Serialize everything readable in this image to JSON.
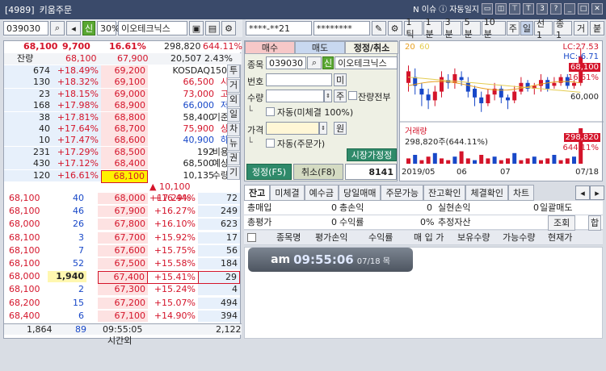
{
  "window": {
    "id": "[4989]",
    "title": "키움주문",
    "news": "N 이슈",
    "journal": "자동일지",
    "badge": "3"
  },
  "left": {
    "code": "039030",
    "shin": "신",
    "margin": "30%",
    "name": "이오테크닉스",
    "price": "68,100",
    "change": "9,700",
    "rate": "16.61%",
    "volume": "298,820",
    "vol_ratio": "644.11%",
    "remain_label": "잔량",
    "ref_price": "68,100",
    "base": "67,900",
    "amt": "20,507",
    "pct": "2.43%",
    "sell_rows": [
      {
        "qty": "674",
        "rate": "+18.49%",
        "price": "69,200"
      },
      {
        "qty": "130",
        "rate": "+18.32%",
        "price": "69,100"
      },
      {
        "qty": "23",
        "rate": "+18.15%",
        "price": "69,000"
      },
      {
        "qty": "168",
        "rate": "+17.98%",
        "price": "68,900"
      },
      {
        "qty": "38",
        "rate": "+17.81%",
        "price": "68,800"
      },
      {
        "qty": "40",
        "rate": "+17.64%",
        "price": "68,700"
      },
      {
        "qty": "10",
        "rate": "+17.47%",
        "price": "68,600"
      },
      {
        "qty": "231",
        "rate": "+17.29%",
        "price": "68,500"
      },
      {
        "qty": "430",
        "rate": "+17.12%",
        "price": "68,400"
      },
      {
        "qty": "120",
        "rate": "+16.61%",
        "price": "68,100"
      }
    ],
    "info": [
      {
        "v": "KOSDAQ150",
        "l": ""
      },
      {
        "v": "66,500",
        "l": "시"
      },
      {
        "v": "73,000",
        "l": "고"
      },
      {
        "v": "66,000",
        "l": "저"
      },
      {
        "v": "58,400",
        "l": "기준"
      },
      {
        "v": "75,900",
        "l": "상"
      },
      {
        "v": "40,900",
        "l": "하"
      },
      {
        "v": "192",
        "l": "비용"
      },
      {
        "v": "68,500",
        "l": "예상"
      },
      {
        "v": "10,135",
        "l": "수량"
      },
      {
        "v": "▲ 10,100 +17.29%",
        "l": ""
      }
    ],
    "vtabs": [
      "투",
      "거",
      "외",
      "일",
      "차",
      "뉴",
      "권",
      "기"
    ],
    "buy_rows": [
      {
        "tick": "68,100",
        "q": "40",
        "price": "68,000",
        "rate": "+16.44%",
        "qty": "72"
      },
      {
        "tick": "68,100",
        "q": "46",
        "price": "67,900",
        "rate": "+16.27%",
        "qty": "249"
      },
      {
        "tick": "68,000",
        "q": "26",
        "price": "67,800",
        "rate": "+16.10%",
        "qty": "623"
      },
      {
        "tick": "68,100",
        "q": "3",
        "price": "67,700",
        "rate": "+15.92%",
        "qty": "17"
      },
      {
        "tick": "68,100",
        "q": "7",
        "price": "67,600",
        "rate": "+15.75%",
        "qty": "56"
      },
      {
        "tick": "68,100",
        "q": "52",
        "price": "67,500",
        "rate": "+15.58%",
        "qty": "184"
      },
      {
        "tick": "68,000",
        "q": "1,940",
        "price": "67,400",
        "rate": "+15.41%",
        "qty": "29"
      },
      {
        "tick": "68,100",
        "q": "2",
        "price": "67,300",
        "rate": "+15.24%",
        "qty": "4"
      },
      {
        "tick": "68,200",
        "q": "15",
        "price": "67,200",
        "rate": "+15.07%",
        "qty": "494"
      },
      {
        "tick": "68,400",
        "q": "6",
        "price": "67,100",
        "rate": "+14.90%",
        "qty": "394"
      }
    ],
    "total_sell": "1,864",
    "total_89": "89",
    "time": "09:55:05",
    "total_buy": "2,122",
    "after": "시간외"
  },
  "order": {
    "account": "****-**21",
    "password": "********",
    "top_tabs": [
      "1틱",
      "1분",
      "3분",
      "5분",
      "10분",
      "주",
      "일",
      "선1",
      "종1"
    ],
    "small": "거",
    "paste": "붙",
    "tabs": [
      "매수",
      "매도",
      "정정/취소"
    ],
    "code_label": "종목",
    "code": "039030",
    "shin": "신",
    "name": "이오테크닉스",
    "no_label": "번호",
    "no_btn": "미",
    "qty_label": "수량",
    "qty_btn": "주",
    "remain_all": "잔량전부",
    "auto1": "자동(미체결 100%)",
    "price_label": "가격",
    "price_btn": "원",
    "auto2": "자동(주문가)",
    "market": "시장가정정",
    "modify": "정정(F5)",
    "cancel": "취소(F8)",
    "count": "8141"
  },
  "chart": {
    "ma": [
      "20",
      "60"
    ],
    "lc": "LC:27.53",
    "hc": "HC:-6.71",
    "price": "68,100",
    "rate": "16.61%",
    "level": "60,000",
    "vol_label": "거래량",
    "vol": "298,820주(644.11%)",
    "vol_tag": "298,820",
    "vol_tag2": "644.11%",
    "x": [
      "2019/05",
      "06",
      "07",
      "07/18"
    ],
    "series": [
      {
        "name": "20",
        "color": "#e8a020"
      },
      {
        "name": "60",
        "color": "#e4cc50"
      }
    ]
  },
  "balance": {
    "tabs": [
      "잔고",
      "미체결",
      "예수금",
      "당일매매",
      "주문가능",
      "잔고확인",
      "체결확인",
      "차트"
    ],
    "r1": {
      "a": "총매입",
      "av": "0",
      "b": "총손익",
      "bv": "0",
      "c": "실현손익",
      "cv": "0",
      "d": "일괄매도"
    },
    "r2": {
      "a": "총평가",
      "av": "0",
      "b": "수익률",
      "bv": "0%",
      "c": "추정자산",
      "cv": "",
      "d": "조회",
      "e": "합"
    },
    "cols": [
      "종목명",
      "평가손익",
      "수익률",
      "매 입 가",
      "보유수량",
      "가능수량",
      "현재가"
    ],
    "clock": {
      "am": "am",
      "time": "09:55:06",
      "date": "07/18 목"
    }
  }
}
